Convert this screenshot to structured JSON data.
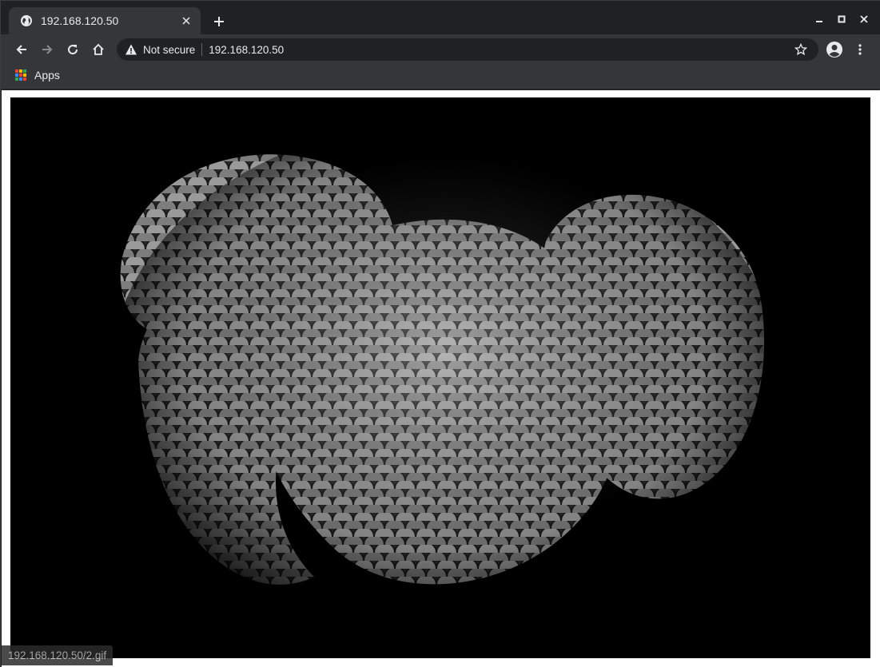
{
  "tab": {
    "title": "192.168.120.50",
    "favicon": "globe-icon"
  },
  "toolbar": {
    "security_label": "Not secure",
    "url": "192.168.120.50"
  },
  "bookmarks": {
    "apps_label": "Apps"
  },
  "content": {
    "image_subject": "coiled snake scales"
  },
  "status_bar": {
    "link": "192.168.120.50/2.gif"
  },
  "colors": {
    "chrome_dark": "#202124",
    "chrome_mid": "#35363a",
    "text": "#e8eaed"
  }
}
